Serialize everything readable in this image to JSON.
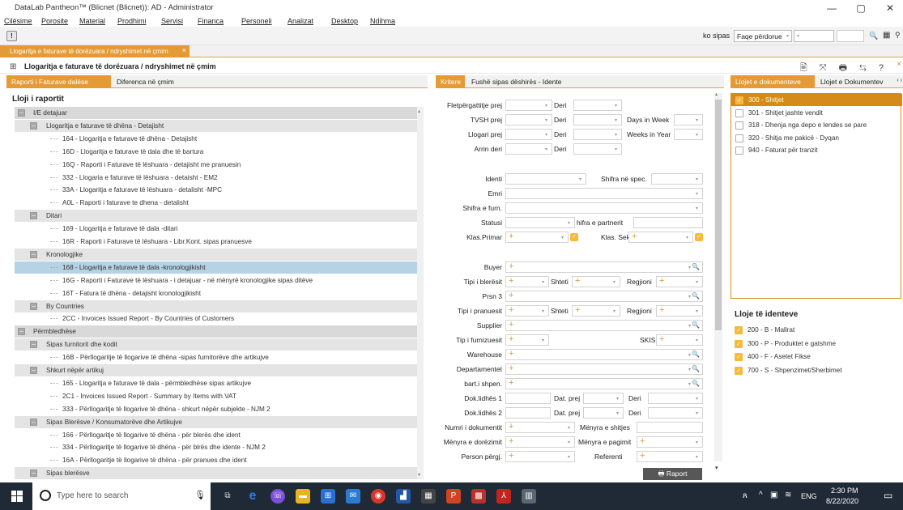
{
  "app": {
    "title": "DataLab Pantheon™ (Blicnet (Blicnet)): AD - Administrator",
    "min": "—",
    "max": "▢",
    "close": "✕"
  },
  "menu": [
    "Cilësime",
    "Porosite",
    "Material",
    "Prodhimi",
    "Servisi",
    "Financa",
    "Personeli",
    "Analizat",
    "Desktop",
    "Ndihma"
  ],
  "toolbar": {
    "info": "!",
    "search_label": "ko sipas",
    "search_select": "Faqe përdorue",
    "search_select2": "",
    "search_input": "",
    "search_icon": "🔍",
    "grid_icon": "▦"
  },
  "doc_tab": {
    "label": "Llogaritja e faturave të dorëzuara / ndryshimet në çmim",
    "close": "×"
  },
  "form": {
    "title": "Llogaritja e faturave të dorëzuara / ndryshimet në çmim",
    "icons": "🖹 ⤧ 🖶 ⇆ ?",
    "close": "×"
  },
  "left": {
    "tabs": [
      "Raporti i Faturave dalëse",
      "Diferenca në çmim"
    ],
    "heading": "Lloji i raportit",
    "rows": [
      {
        "t": "I/E detajuar",
        "lvl": 0,
        "grp": 1
      },
      {
        "t": "Llogaritja e faturave të dhëna - Detajisht",
        "lvl": 1,
        "grp": 2
      },
      {
        "t": "164 - Llogaritja e faturave të dhëna - Detajisht",
        "lvl": 2
      },
      {
        "t": "16D - Llogaritja e faturave të dala dhe të bartura",
        "lvl": 2
      },
      {
        "t": "16Q - Raporti i Faturave të lëshuara - detajisht me pranuesin",
        "lvl": 2
      },
      {
        "t": "332 - Llogaria e faturave të lëshuara - detaisht - EM2",
        "lvl": 2
      },
      {
        "t": "33A - Llogaritja e faturave të lëshuara - detalisht -MPC",
        "lvl": 2
      },
      {
        "t": "A0L - Raporti i faturave te dhena - detalisht",
        "lvl": 2
      },
      {
        "t": "Ditari",
        "lvl": 1,
        "grp": 2
      },
      {
        "t": "169 - Llogaritja e faturave të dala -ditari",
        "lvl": 2
      },
      {
        "t": "16R - Raporti i Faturave të lëshuara - Libr.Kont. sipas pranuesve",
        "lvl": 2
      },
      {
        "t": "Kronologjike",
        "lvl": 1,
        "grp": 2
      },
      {
        "t": "168 - Llogaritja e faturave të dala -kronologjikisht",
        "lvl": 2,
        "sel": 1
      },
      {
        "t": "16G - Raporti i Faturave të lëshuara - i detajuar - në mënyrë kronologjike sipas ditëve",
        "lvl": 2
      },
      {
        "t": "16T - Fatura të dhëna - detajisht kronologjikisht",
        "lvl": 2
      },
      {
        "t": "By Countries",
        "lvl": 1,
        "grp": 2
      },
      {
        "t": "2CC - Invoices Issued Report - By Countries of Customers",
        "lvl": 2
      },
      {
        "t": "Përmbledhëse",
        "lvl": 0,
        "grp": 1
      },
      {
        "t": "Sipas furnitorit dhe kodit",
        "lvl": 1,
        "grp": 2
      },
      {
        "t": "16B - Përllogaritje të llogarive të dhëna -sipas furnitorëve dhe artikujve",
        "lvl": 2
      },
      {
        "t": "Shkurt nëpër artikuj",
        "lvl": 1,
        "grp": 2
      },
      {
        "t": "165 - Llogaritja e faturave të dala - përmbledhëse sipas artikujve",
        "lvl": 2
      },
      {
        "t": "2C1 - Invoices Issued Report - Summary by Items with VAT",
        "lvl": 2
      },
      {
        "t": "333 - Përllogaritje të llogarive të dhëna - shkurt nëpër subjekte - NJM 2",
        "lvl": 2
      },
      {
        "t": "Sipas Blerësve / Konsumatorëve dhe Artikujve",
        "lvl": 1,
        "grp": 2
      },
      {
        "t": "166 - Përllogaritje të llogarive të dhëna - për blerës dhe ident",
        "lvl": 2
      },
      {
        "t": "334 - Përllogaritje të llogarive të dhëna - për blrës dhe idente - NJM 2",
        "lvl": 2
      },
      {
        "t": "16A - Përllogaritje të llogarive të dhëna - për pranues dhe ident",
        "lvl": 2
      },
      {
        "t": "Sipas blerësve",
        "lvl": 1,
        "grp": 2
      }
    ]
  },
  "mid": {
    "tabs": [
      "Kritere",
      "Fushë sipas dëshirës - Idente"
    ],
    "labels": {
      "fletpergatitje": "Fletpërgattitje prej",
      "deri": "Deri",
      "tvsh": "TVSH prej",
      "days": "Days in Week",
      "llogari": "Llogari prej",
      "weeks": "Weeks in Year",
      "arrin": "Arrin deri",
      "identi": "Identi",
      "shifra_spec": "Shifra në spec.",
      "emri": "Emri",
      "shifra_furn": "Shifra e furn.",
      "statusi": "Statusi",
      "shifra_partner": "hifra e partnerit",
      "klas_primar": "Klas.Primar",
      "klas_sek": "Klas. Sek.",
      "buyer": "Buyer",
      "tipi_bleresit": "Tipi i blerësit",
      "shteti": "Shteti",
      "regjioni": "Regjioni",
      "prsn3": "Prsn 3",
      "tipi_pranuesit": "Tipi i pranuesit",
      "supplier": "Supplier",
      "tip_furn": "Tip i furnizuesit",
      "skis": "SKIS",
      "warehouse": "Warehouse",
      "departamentet": "Departamentet",
      "bart": "bart.i shpen.",
      "dok1": "Dok.lidhës 1",
      "dok2": "Dok.lidhës 2",
      "dat_prej": "Dat. prej",
      "numri": "Numri i dokumentit",
      "menyra_shitjes": "Mënyra e shitjes",
      "menyra_dorezimit": "Mënyra e dorëzimit",
      "menyra_pagimit": "Mënyra e pagimit",
      "person": "Person përgj.",
      "referenti": "Referenti"
    },
    "raport_button": "🖶 Raport"
  },
  "right": {
    "tabs": [
      "Llojet e dokumenteve",
      "Llojet e Dokumentev"
    ],
    "docs": [
      {
        "t": "300 - Shitjet",
        "on": true,
        "sel": true
      },
      {
        "t": "301 - Shitjet jashte vendit",
        "on": false
      },
      {
        "t": "318 - Dhenja nga depo e lendes se pare",
        "on": false
      },
      {
        "t": "320 - Shitja me pakicë - Dyqan",
        "on": false
      },
      {
        "t": "940 - Faturat për tranzit",
        "on": false
      }
    ],
    "ident_heading": "Lloje të identeve",
    "idents": [
      {
        "t": "200 - B - Mallrat",
        "on": true
      },
      {
        "t": "300 - P - Produktet e gatshme",
        "on": true
      },
      {
        "t": "400 - F - Asetet Fikse",
        "on": true
      },
      {
        "t": "700 - S - Shpenzimet/Sherbimet",
        "on": true
      }
    ]
  },
  "taskbar": {
    "search": "Type here to search",
    "lang": "ENG",
    "time": "2:30 PM",
    "date": "8/22/2020"
  }
}
